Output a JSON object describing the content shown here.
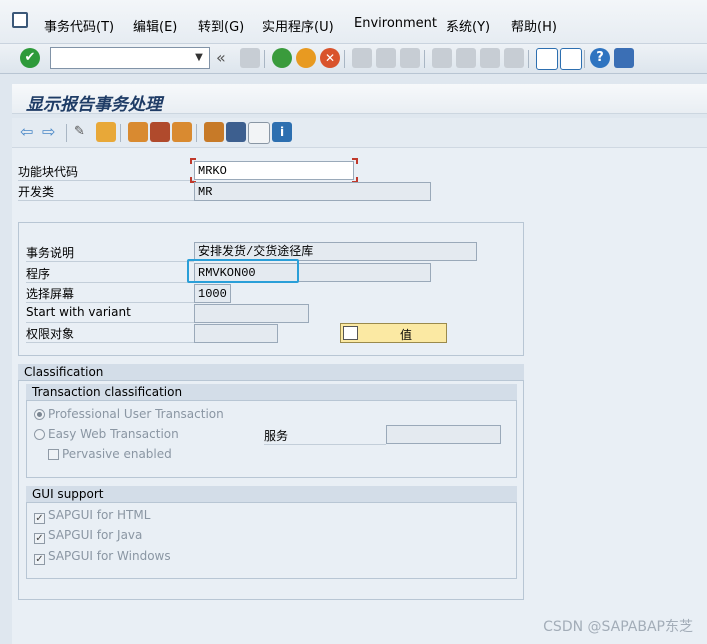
{
  "menu": {
    "items": [
      "事务代码(T)",
      "编辑(E)",
      "转到(G)",
      "实用程序(U)",
      "Environment",
      "系统(Y)",
      "帮助(H)"
    ]
  },
  "page": {
    "title": "显示报告事务处理"
  },
  "form": {
    "function_module_label": "功能块代码",
    "function_module_value": "MRKO",
    "dev_class_label": "开发类",
    "dev_class_value": "MR",
    "description_label": "事务说明",
    "description_value": "安排发货/交货途径库",
    "program_label": "程序",
    "program_value": "RMVKON00",
    "screen_label": "选择屏幕",
    "screen_value": "1000",
    "variant_label": "Start with variant",
    "variant_value": "",
    "auth_label": "权限对象",
    "auth_value": "",
    "value_button": "值"
  },
  "classification": {
    "title": "Classification",
    "tx_title": "Transaction classification",
    "professional": "Professional User Transaction",
    "easy_web": "Easy Web Transaction",
    "service_label": "服务",
    "service_value": "",
    "pervasive": "Pervasive enabled",
    "gui_title": "GUI support",
    "gui_html": "SAPGUI for HTML",
    "gui_java": "SAPGUI for Java",
    "gui_windows": "SAPGUI for Windows"
  },
  "watermark": "CSDN @SAPABAP东芝",
  "colors": {
    "accent": "#1f3c66",
    "highlight": "#2a9fd8",
    "marker": "#c0392b",
    "button": "#fbe9a3"
  }
}
